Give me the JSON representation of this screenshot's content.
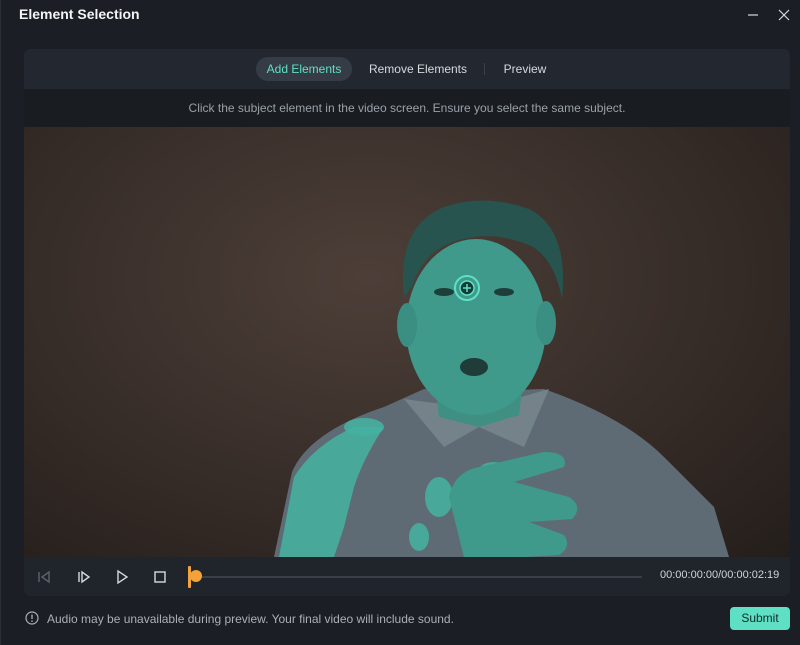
{
  "window": {
    "title": "Element Selection",
    "minimize_icon": "minimize-icon",
    "close_icon": "close-icon"
  },
  "tabs": [
    {
      "label": "Add Elements",
      "active": true
    },
    {
      "label": "Remove Elements",
      "active": false
    },
    {
      "label": "Preview",
      "active": false
    }
  ],
  "hint": "Click the subject element in the video screen. Ensure you select the same subject.",
  "player": {
    "icons": [
      "prev-frame-icon",
      "next-frame-icon",
      "play-icon",
      "stop-icon"
    ],
    "progress": 0.0,
    "timecode": "00:00:00:00/00:00:02:19"
  },
  "footer": {
    "notice_icon": "info-icon",
    "notice": "Audio may be unavailable during preview. Your final video will include sound.",
    "submit_label": "Submit"
  },
  "colors": {
    "accent": "#5fe0c4",
    "playhead": "#f5a23a",
    "background": "#1b1f25"
  }
}
